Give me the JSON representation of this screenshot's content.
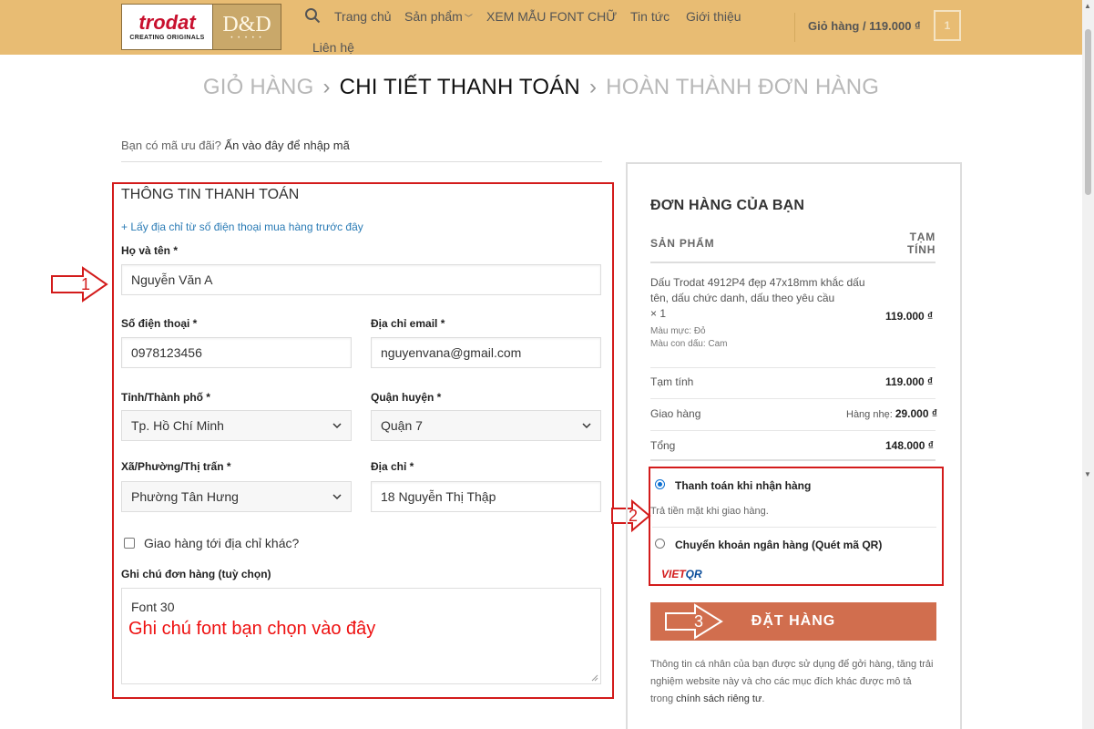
{
  "header": {
    "logo_brand": "trodat",
    "logo_tagline": "CREATING ORIGINALS",
    "logo_dd": "D&D",
    "nav": [
      "Trang chủ",
      "Sản phẩm",
      "XEM MẪU FONT CHỮ",
      "Tin tức",
      "Giới thiệu",
      "Liên hệ"
    ],
    "cart_label": "Giỏ hàng / 119.000 ₫",
    "cart_count": "1"
  },
  "breadcrumb": {
    "step1": "GIỎ HÀNG",
    "step2": "CHI TIẾT THANH TOÁN",
    "step3": "HOÀN THÀNH ĐƠN HÀNG",
    "separator": "›"
  },
  "coupon": {
    "prompt": "Bạn có mã ưu đãi?",
    "link": "Ấn vào đây để nhập mã"
  },
  "billing": {
    "title": "THÔNG TIN THANH TOÁN",
    "prev_address_link": "+ Lấy địa chỉ từ số điện thoại mua hàng trước đây",
    "name_label": "Họ và tên *",
    "name_value": "Nguyễn Văn A",
    "phone_label": "Số điện thoại *",
    "phone_value": "0978123456",
    "email_label": "Địa chỉ email *",
    "email_value": "nguyenvana@gmail.com",
    "city_label": "Tỉnh/Thành phố *",
    "city_value": "Tp. Hồ Chí Minh",
    "district_label": "Quận huyện *",
    "district_value": "Quận 7",
    "ward_label": "Xã/Phường/Thị trấn *",
    "ward_value": "Phường Tân Hưng",
    "address_label": "Địa chỉ *",
    "address_value": "18 Nguyễn Thị Thập",
    "ship_other_label": "Giao hàng tới địa chỉ khác?",
    "notes_label": "Ghi chú đơn hàng (tuỳ chọn)",
    "notes_value": "Font 30",
    "notes_hint": "Ghi chú font bạn chọn vào đây"
  },
  "annotations": {
    "arrow1": "1",
    "arrow2": "2",
    "arrow3": "3"
  },
  "order": {
    "title": "ĐƠN HÀNG CỦA BẠN",
    "col_product": "SẢN PHẨM",
    "col_subtotal_1": "TẠM",
    "col_subtotal_2": "TÍNH",
    "product_name": "Dấu Trodat 4912P4 đẹp 47x18mm khắc dấu tên, dấu chức danh, dấu theo yêu cầu",
    "product_qty": "× 1",
    "ink_label": "Màu mực:",
    "ink_value": "Đỏ",
    "stamp_label": "Màu con dấu:",
    "stamp_value": "Cam",
    "product_price": "119.000 ₫",
    "subtotal_label": "Tạm tính",
    "subtotal_value": "119.000 ₫",
    "shipping_label": "Giao hàng",
    "shipping_method": "Hàng nhẹ:",
    "shipping_value": "29.000 ₫",
    "total_label": "Tổng",
    "total_value": "148.000 ₫",
    "pay_cod_label": "Thanh toán khi nhận hàng",
    "pay_cod_desc": "Trả tiền mặt khi giao hàng.",
    "pay_bank_label": "Chuyển khoản ngân hàng (Quét mã QR)",
    "vietqr_viet": "VIET",
    "vietqr_qr": "QR",
    "place_order": "ĐẶT HÀNG",
    "privacy_text": "Thông tin cá nhân của bạn được sử dụng để gởi hàng, tăng trải nghiệm website này và cho các mục đích khác được mô tả trong",
    "privacy_link": "chính sách riêng tư",
    "privacy_end": "."
  },
  "colors": {
    "header_bg": "#e8bc73",
    "annotation_red": "#d31b1b",
    "order_button": "#d16e4e",
    "link_blue": "#2a7bb5"
  }
}
